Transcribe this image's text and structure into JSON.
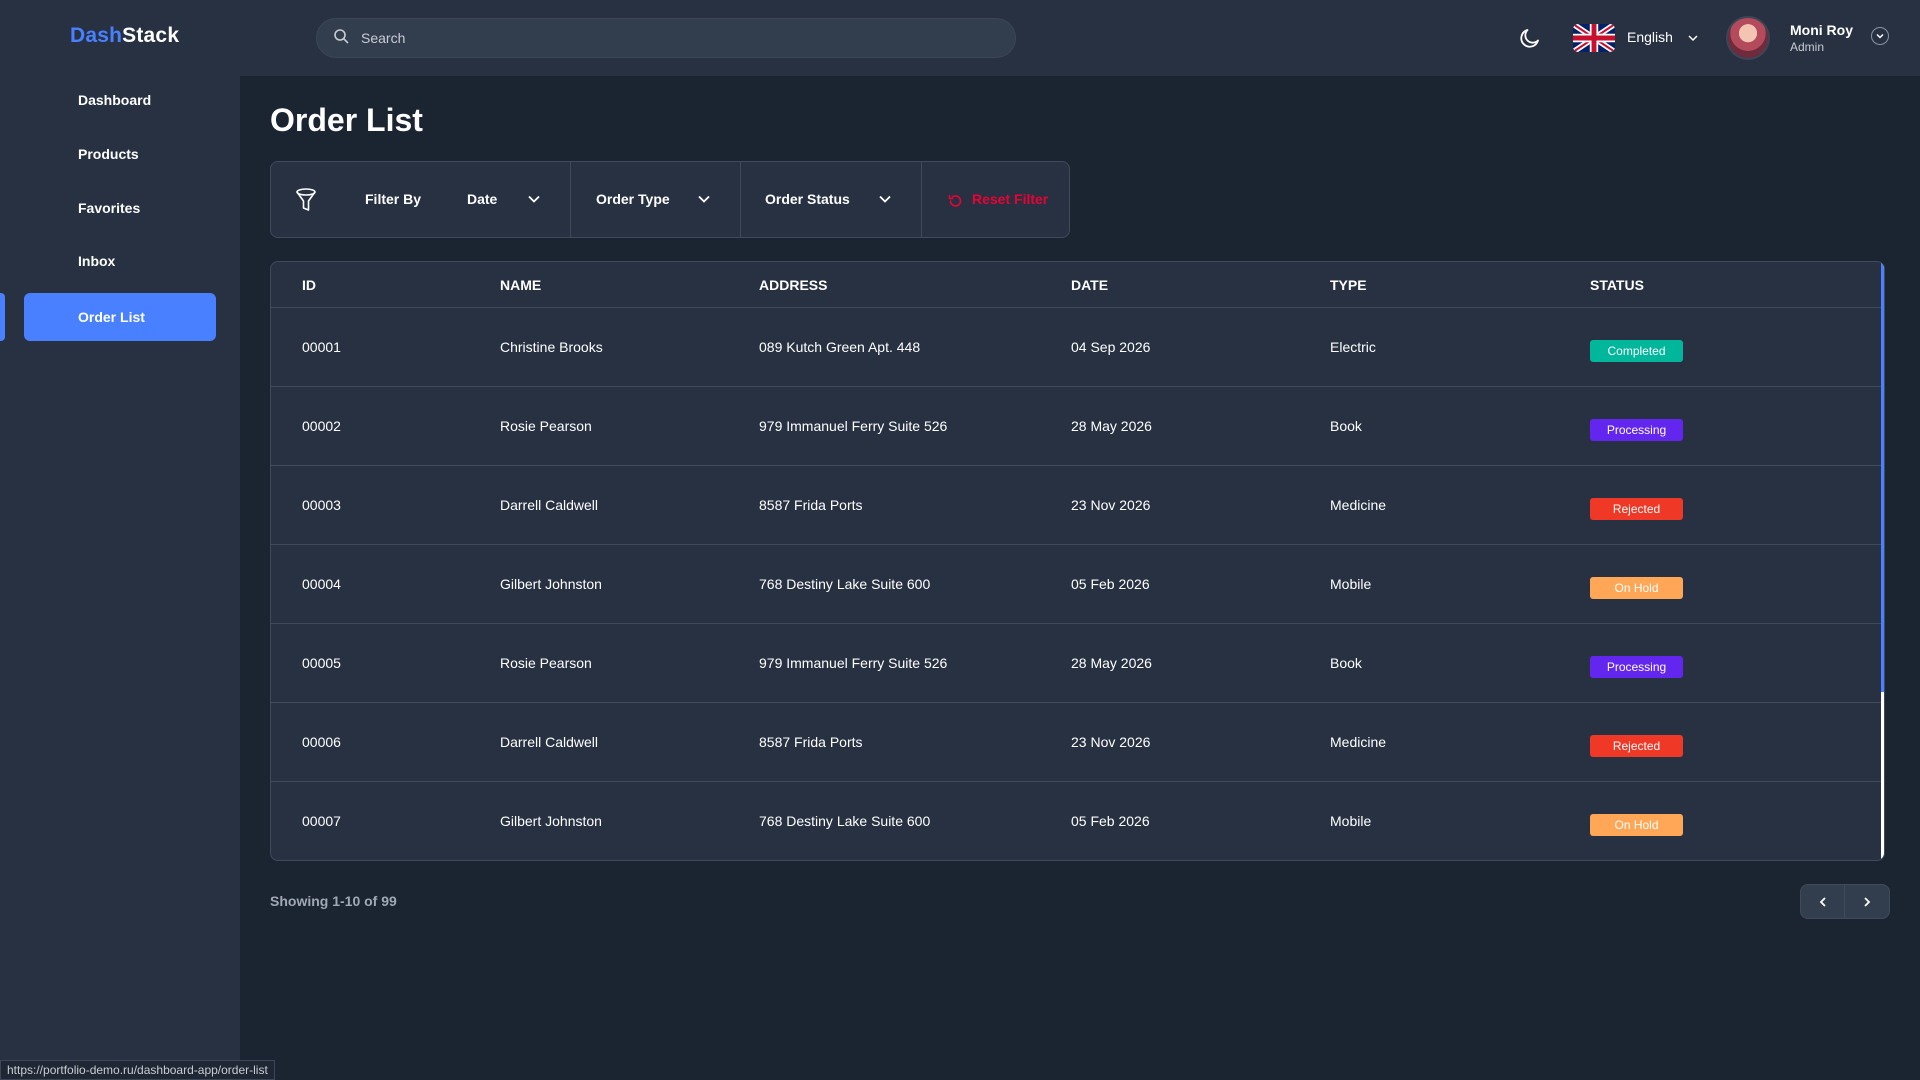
{
  "app": {
    "logo_part1": "Dash",
    "logo_part2": "Stack"
  },
  "header": {
    "search_placeholder": "Search",
    "language": "English",
    "user_name": "Moni Roy",
    "user_role": "Admin"
  },
  "sidebar": {
    "items": [
      {
        "label": "Dashboard"
      },
      {
        "label": "Products"
      },
      {
        "label": "Favorites"
      },
      {
        "label": "Inbox"
      },
      {
        "label": "Order List",
        "active": true
      }
    ]
  },
  "page": {
    "title": "Order List"
  },
  "filters": {
    "filter_by": "Filter By",
    "date": "Date",
    "order_type": "Order Type",
    "order_status": "Order Status",
    "reset": "Reset Filter"
  },
  "table": {
    "headers": [
      "ID",
      "NAME",
      "ADDRESS",
      "DATE",
      "TYPE",
      "STATUS"
    ],
    "rows": [
      {
        "id": "00001",
        "name": "Christine Brooks",
        "address": "089 Kutch Green Apt. 448",
        "date": "04 Sep 2026",
        "type": "Electric",
        "status": "Completed"
      },
      {
        "id": "00002",
        "name": "Rosie Pearson",
        "address": "979 Immanuel Ferry Suite 526",
        "date": "28 May 2026",
        "type": "Book",
        "status": "Processing"
      },
      {
        "id": "00003",
        "name": "Darrell Caldwell",
        "address": "8587 Frida Ports",
        "date": "23 Nov 2026",
        "type": "Medicine",
        "status": "Rejected"
      },
      {
        "id": "00004",
        "name": "Gilbert Johnston",
        "address": "768 Destiny Lake Suite 600",
        "date": "05 Feb 2026",
        "type": "Mobile",
        "status": "On Hold"
      },
      {
        "id": "00005",
        "name": "Rosie Pearson",
        "address": "979 Immanuel Ferry Suite 526",
        "date": "28 May 2026",
        "type": "Book",
        "status": "Processing"
      },
      {
        "id": "00006",
        "name": "Darrell Caldwell",
        "address": "8587 Frida Ports",
        "date": "23 Nov 2026",
        "type": "Medicine",
        "status": "Rejected"
      },
      {
        "id": "00007",
        "name": "Gilbert Johnston",
        "address": "768 Destiny Lake Suite 600",
        "date": "05 Feb 2026",
        "type": "Mobile",
        "status": "On Hold"
      }
    ]
  },
  "status_colors": {
    "Completed": "#00b69b",
    "Processing": "#6226ef",
    "Rejected": "#ef3826",
    "On Hold": "#ffa756"
  },
  "pagination": {
    "showing": "Showing 1-10 of 99"
  },
  "browser": {
    "status_url": "https://portfolio-demo.ru/dashboard-app/order-list"
  },
  "icons": {
    "search": "search-icon",
    "theme": "moon-icon",
    "flag": "uk-flag-icon",
    "filter": "funnel-icon",
    "reset": "reset-icon",
    "chevron": "chevron-down-icon",
    "prev": "chevron-left-icon",
    "next": "chevron-right-icon"
  }
}
